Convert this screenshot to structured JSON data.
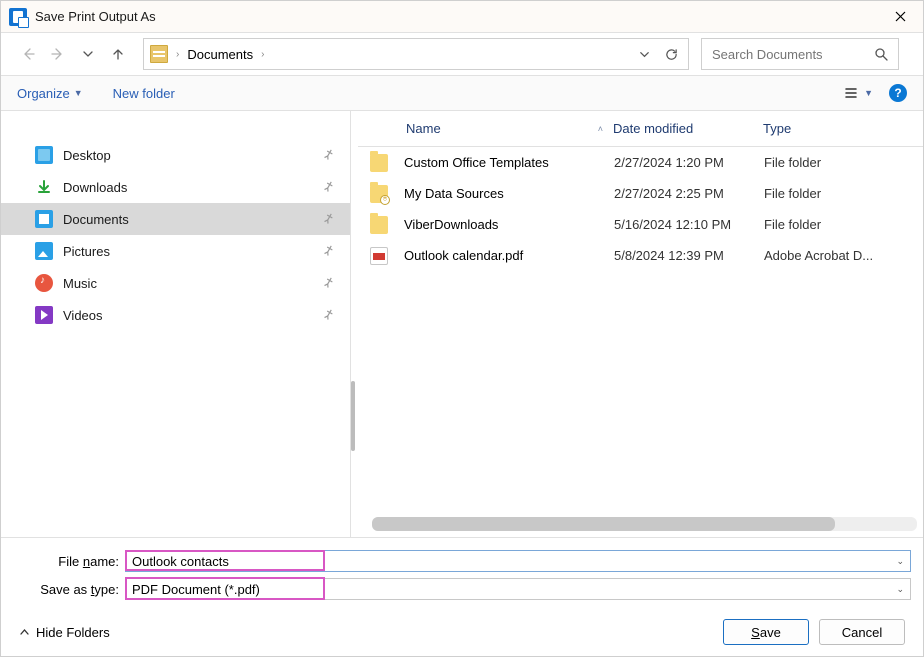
{
  "title": "Save Print Output As",
  "address": {
    "folder": "Documents"
  },
  "search": {
    "placeholder": "Search Documents"
  },
  "toolbar": {
    "organize": "Organize",
    "new_folder": "New folder"
  },
  "sidebar": {
    "items": [
      {
        "label": "Desktop"
      },
      {
        "label": "Downloads"
      },
      {
        "label": "Documents"
      },
      {
        "label": "Pictures"
      },
      {
        "label": "Music"
      },
      {
        "label": "Videos"
      }
    ]
  },
  "columns": {
    "name": "Name",
    "date": "Date modified",
    "type": "Type"
  },
  "files": [
    {
      "name": "Custom Office Templates",
      "date": "2/27/2024 1:20 PM",
      "type": "File folder",
      "icon": "folder"
    },
    {
      "name": "My Data Sources",
      "date": "2/27/2024 2:25 PM",
      "type": "File folder",
      "icon": "folder-db"
    },
    {
      "name": "ViberDownloads",
      "date": "5/16/2024 12:10 PM",
      "type": "File folder",
      "icon": "folder"
    },
    {
      "name": "Outlook calendar.pdf",
      "date": "5/8/2024 12:39 PM",
      "type": "Adobe Acrobat D...",
      "icon": "pdf"
    }
  ],
  "fields": {
    "filename_label_pre": "File ",
    "filename_label_u": "n",
    "filename_label_post": "ame:",
    "filename_value": "Outlook contacts",
    "type_label_pre": "Save as ",
    "type_label_u": "t",
    "type_label_post": "ype:",
    "type_value": "PDF Document (*.pdf)"
  },
  "footer": {
    "hide_folders": "Hide Folders",
    "save_u": "S",
    "save_rest": "ave",
    "cancel": "Cancel"
  }
}
